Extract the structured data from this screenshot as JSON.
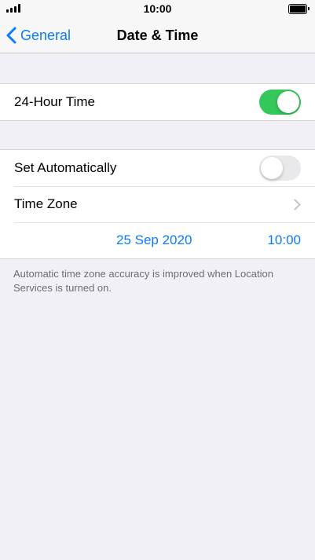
{
  "status_bar": {
    "time": "10:00"
  },
  "nav": {
    "back_label": "General",
    "title": "Date & Time"
  },
  "settings": {
    "hour24": {
      "label": "24-Hour Time",
      "enabled": true
    },
    "set_automatically": {
      "label": "Set Automatically",
      "enabled": false
    },
    "time_zone": {
      "label": "Time Zone"
    },
    "date": "25 Sep 2020",
    "time": "10:00"
  },
  "footer_note": "Automatic time zone accuracy is improved when Location Services is turned on.",
  "colors": {
    "accent": "#0a7aff",
    "toggle_on": "#34c759",
    "background": "#f0f0f6"
  }
}
